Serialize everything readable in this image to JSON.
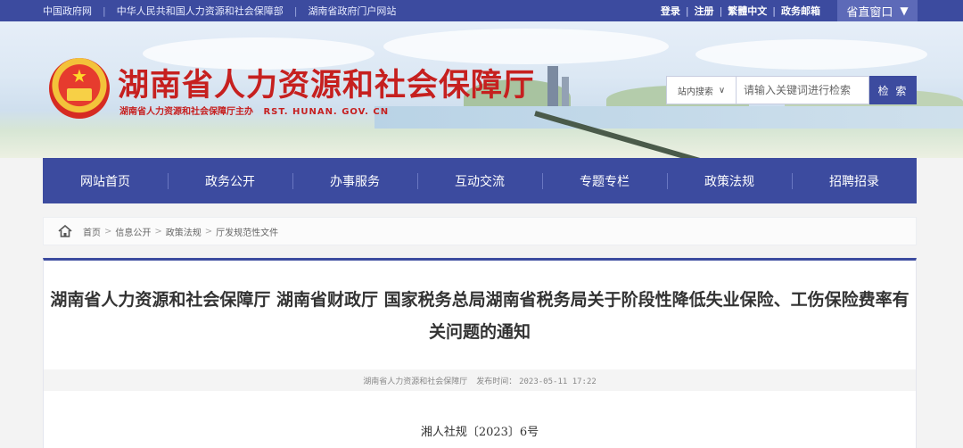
{
  "topbar": {
    "links": [
      "中国政府网",
      "中华人民共和国人力资源和社会保障部",
      "湖南省政府门户网站"
    ],
    "user_links": [
      "登录",
      "注册",
      "繁體中文",
      "政务邮箱"
    ],
    "window_label": "省直窗口",
    "window_arrow": "▼"
  },
  "header": {
    "title": "湖南省人力资源和社会保障厅",
    "subtitle": "湖南省人力资源和社会保障厅主办",
    "domain": "RST. HUNAN. GOV. CN"
  },
  "search": {
    "scope_label": "站内搜索",
    "scope_arrow": "∨",
    "placeholder": "请输入关键词进行检索",
    "button_label": "检 索"
  },
  "nav": {
    "items": [
      "网站首页",
      "政务公开",
      "办事服务",
      "互动交流",
      "专题专栏",
      "政策法规",
      "招聘招录"
    ]
  },
  "breadcrumb": {
    "items": [
      "首页",
      "信息公开",
      "政策法规",
      "厅发规范性文件"
    ],
    "separator": ">"
  },
  "article": {
    "title": "湖南省人力资源和社会保障厅 湖南省财政厅 国家税务总局湖南省税务局关于阶段性降低失业保险、工伤保险费率有关问题的通知",
    "source": "湖南省人力资源和社会保障厅",
    "publish_label": "发布时间：",
    "publish_time": "2023-05-11 17:22",
    "doc_number": "湘人社规〔2023〕6号"
  },
  "colors": {
    "primary": "#3c4b9f",
    "title_red": "#c6201f"
  }
}
